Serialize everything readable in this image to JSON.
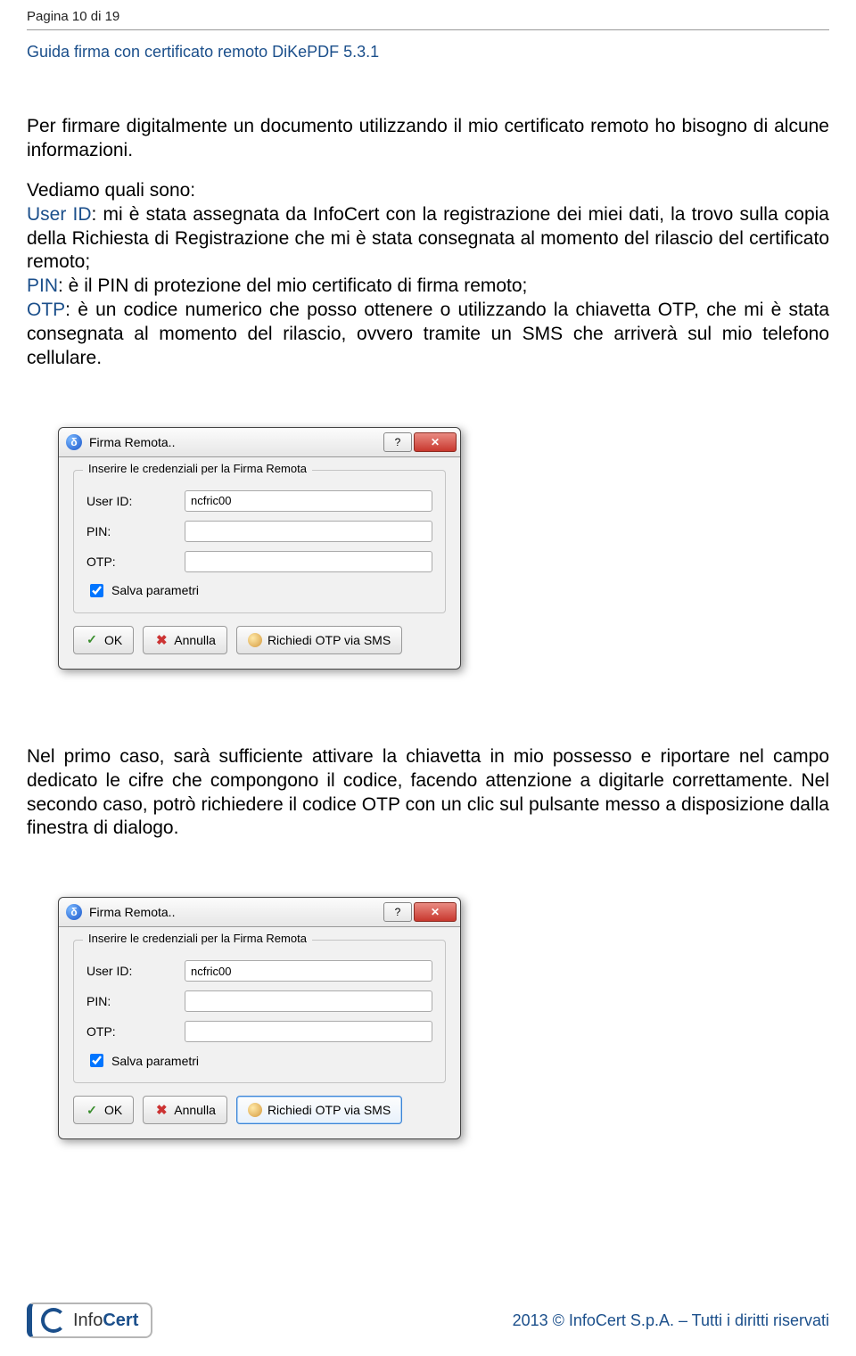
{
  "header": {
    "page_label": "Pagina 10 di 19",
    "doc_title": "Guida firma con certificato remoto DiKePDF 5.3.1"
  },
  "para1": "Per firmare digitalmente un documento utilizzando il mio certificato remoto ho bisogno di alcune informazioni.",
  "para2_intro": "Vediamo quali sono:",
  "labels": {
    "user_id": "User ID",
    "pin": "PIN",
    "otp": "OTP"
  },
  "desc": {
    "user_id": ": mi è stata assegnata da InfoCert con la registrazione dei miei dati, la trovo sulla copia della Richiesta di Registrazione che mi è stata consegnata al momento del rilascio del certificato remoto;",
    "pin": ": è il PIN di protezione del mio certificato di firma remoto;",
    "otp": ": è un codice numerico che posso ottenere o utilizzando la chiavetta OTP, che mi è stata consegnata al momento del rilascio, ovvero tramite un SMS che arriverà sul mio telefono cellulare."
  },
  "dialog": {
    "title": "Firma Remota..",
    "group_title": "Inserire le credenziali per la Firma Remota",
    "user_id_label": "User ID:",
    "user_id_value": "ncfric00",
    "pin_label": "PIN:",
    "pin_value": "",
    "otp_label": "OTP:",
    "otp_value": "",
    "salva_label": "Salva parametri",
    "ok_label": "OK",
    "annulla_label": "Annulla",
    "richiedi_label": "Richiedi OTP via SMS"
  },
  "para3": "Nel primo caso, sarà sufficiente attivare la chiavetta in mio possesso e riportare nel campo dedicato le cifre che compongono il codice, facendo attenzione a digitarle correttamente. Nel secondo caso, potrò richiedere il codice OTP con un clic sul pulsante messo a disposizione dalla finestra di dialogo.",
  "footer": {
    "logo_prefix": "Info",
    "logo_suffix": "Cert",
    "copyright": "2013 © InfoCert S.p.A. – Tutti i diritti riservati"
  }
}
